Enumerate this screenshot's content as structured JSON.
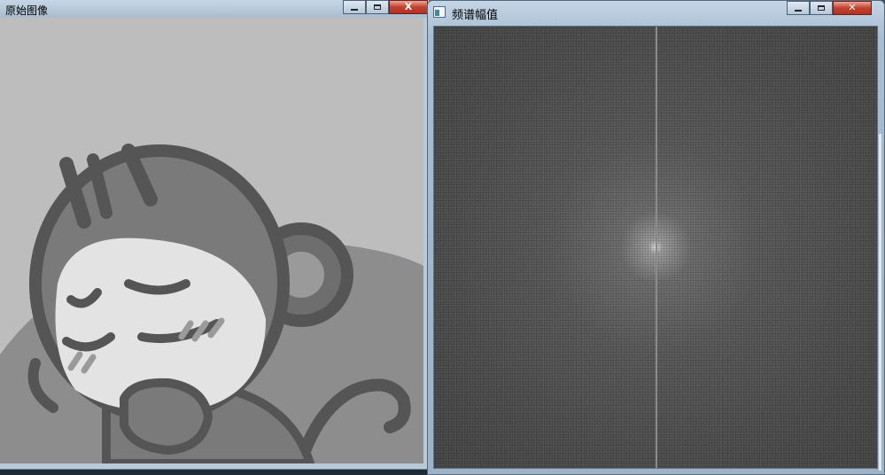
{
  "window_original": {
    "title": "原始图像",
    "buttons": {
      "minimize": "",
      "maximize": "",
      "close": "X"
    }
  },
  "window_spectrum": {
    "title": "频谱幅值",
    "buttons": {
      "minimize": "",
      "maximize": "",
      "close": "✕"
    }
  },
  "icons": [
    "minimize-icon",
    "maximize-icon",
    "close-icon",
    "app-icon"
  ],
  "colors": {
    "close_button": "#c2402f",
    "image_background": "#bdbdbd",
    "spectrum_background": "#4d4d4d"
  }
}
